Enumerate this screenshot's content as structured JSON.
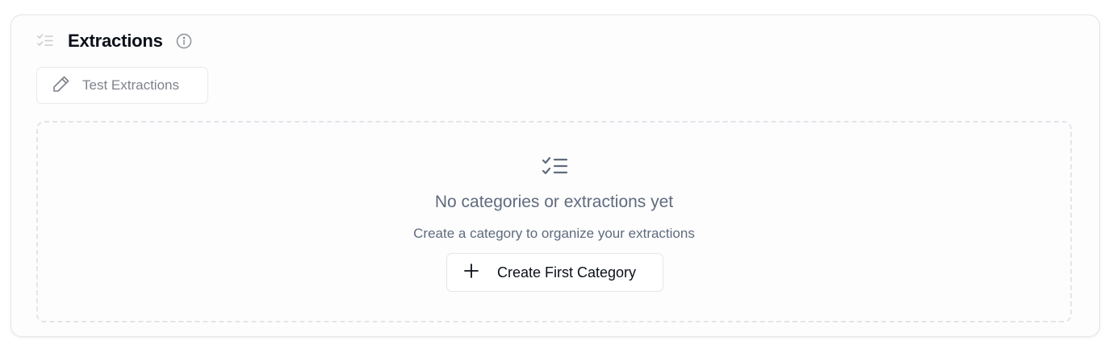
{
  "section": {
    "title": "Extractions"
  },
  "toolbar": {
    "test_label": "Test Extractions"
  },
  "empty_state": {
    "title": "No categories or extractions yet",
    "subtitle": "Create a category to organize your extractions",
    "create_label": "Create First Category"
  },
  "icons": {
    "header": "list-check-icon",
    "info": "info-icon",
    "test": "pencil-icon",
    "empty": "list-check-icon",
    "create": "plus-icon"
  },
  "colors": {
    "title": "#0b0f19",
    "muted": "#5f6b7e",
    "border": "#e2e5ea"
  }
}
